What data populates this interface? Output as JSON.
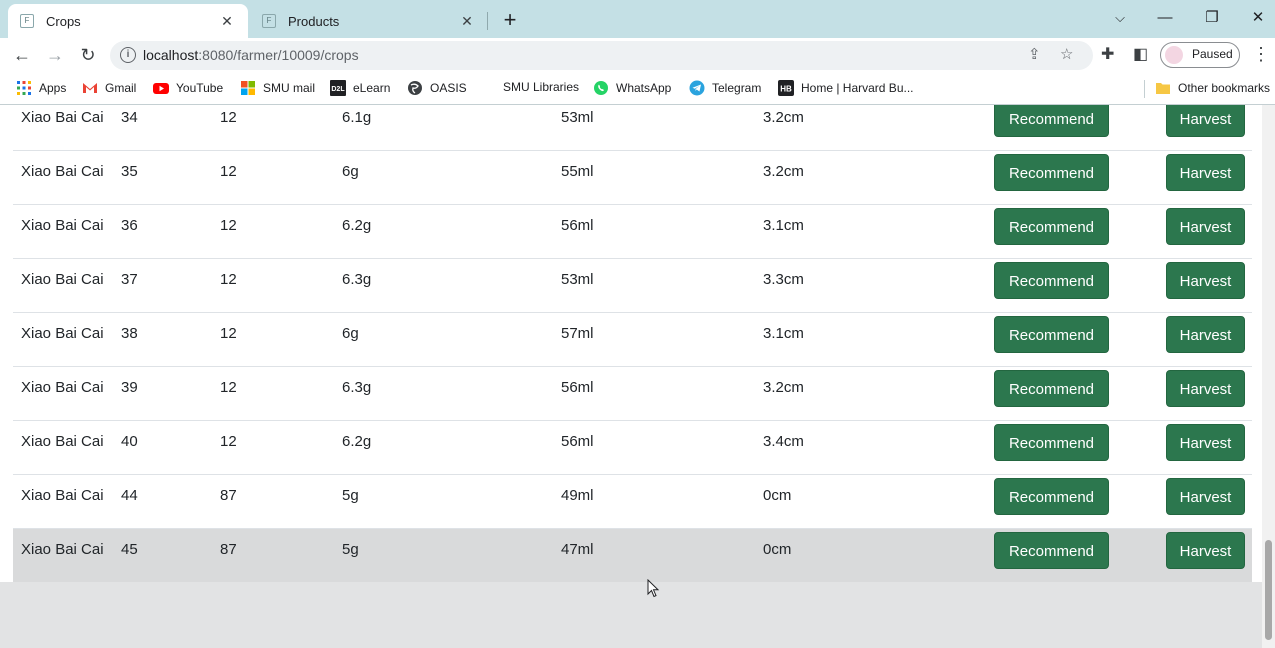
{
  "browser": {
    "tabs": [
      {
        "favicon": "F",
        "title": "Crops",
        "active": true
      },
      {
        "favicon": "F",
        "title": "Products",
        "active": false
      }
    ],
    "url": {
      "host": "localhost",
      "rest": ":8080/farmer/10009/crops"
    },
    "profile_label": "Paused"
  },
  "bookmarks": [
    {
      "label": "Apps",
      "icon": "apps-grid-icon"
    },
    {
      "label": "Gmail",
      "icon": "gmail-icon"
    },
    {
      "label": "YouTube",
      "icon": "youtube-icon"
    },
    {
      "label": "SMU mail",
      "icon": "microsoft-icon"
    },
    {
      "label": "eLearn",
      "icon": "d2l-icon"
    },
    {
      "label": "OASIS",
      "icon": "globe-icon"
    },
    {
      "label": "SMU Libraries",
      "icon": "none"
    },
    {
      "label": "WhatsApp",
      "icon": "whatsapp-icon"
    },
    {
      "label": "Telegram",
      "icon": "telegram-icon"
    },
    {
      "label": "Home | Harvard Bu...",
      "icon": "hb-icon"
    },
    {
      "label": "Other bookmarks",
      "icon": "folder-icon"
    }
  ],
  "icon_text": {
    "d2l": "D2L",
    "hb": "HB"
  },
  "buttons": {
    "recommend": "Recommend",
    "harvest": "Harvest"
  },
  "colors": {
    "button_green": "#2c774e",
    "tabstrip": "#c4e0e5"
  },
  "crops": [
    {
      "name": "Xiao Bai Cai",
      "id": "34",
      "qty": "12",
      "weight": "6.1g",
      "water": "53ml",
      "height": "3.2cm"
    },
    {
      "name": "Xiao Bai Cai",
      "id": "35",
      "qty": "12",
      "weight": "6g",
      "water": "55ml",
      "height": "3.2cm"
    },
    {
      "name": "Xiao Bai Cai",
      "id": "36",
      "qty": "12",
      "weight": "6.2g",
      "water": "56ml",
      "height": "3.1cm"
    },
    {
      "name": "Xiao Bai Cai",
      "id": "37",
      "qty": "12",
      "weight": "6.3g",
      "water": "53ml",
      "height": "3.3cm"
    },
    {
      "name": "Xiao Bai Cai",
      "id": "38",
      "qty": "12",
      "weight": "6g",
      "water": "57ml",
      "height": "3.1cm"
    },
    {
      "name": "Xiao Bai Cai",
      "id": "39",
      "qty": "12",
      "weight": "6.3g",
      "water": "56ml",
      "height": "3.2cm"
    },
    {
      "name": "Xiao Bai Cai",
      "id": "40",
      "qty": "12",
      "weight": "6.2g",
      "water": "56ml",
      "height": "3.4cm"
    },
    {
      "name": "Xiao Bai Cai",
      "id": "44",
      "qty": "87",
      "weight": "5g",
      "water": "49ml",
      "height": "0cm"
    },
    {
      "name": "Xiao Bai Cai",
      "id": "45",
      "qty": "87",
      "weight": "5g",
      "water": "47ml",
      "height": "0cm"
    }
  ]
}
